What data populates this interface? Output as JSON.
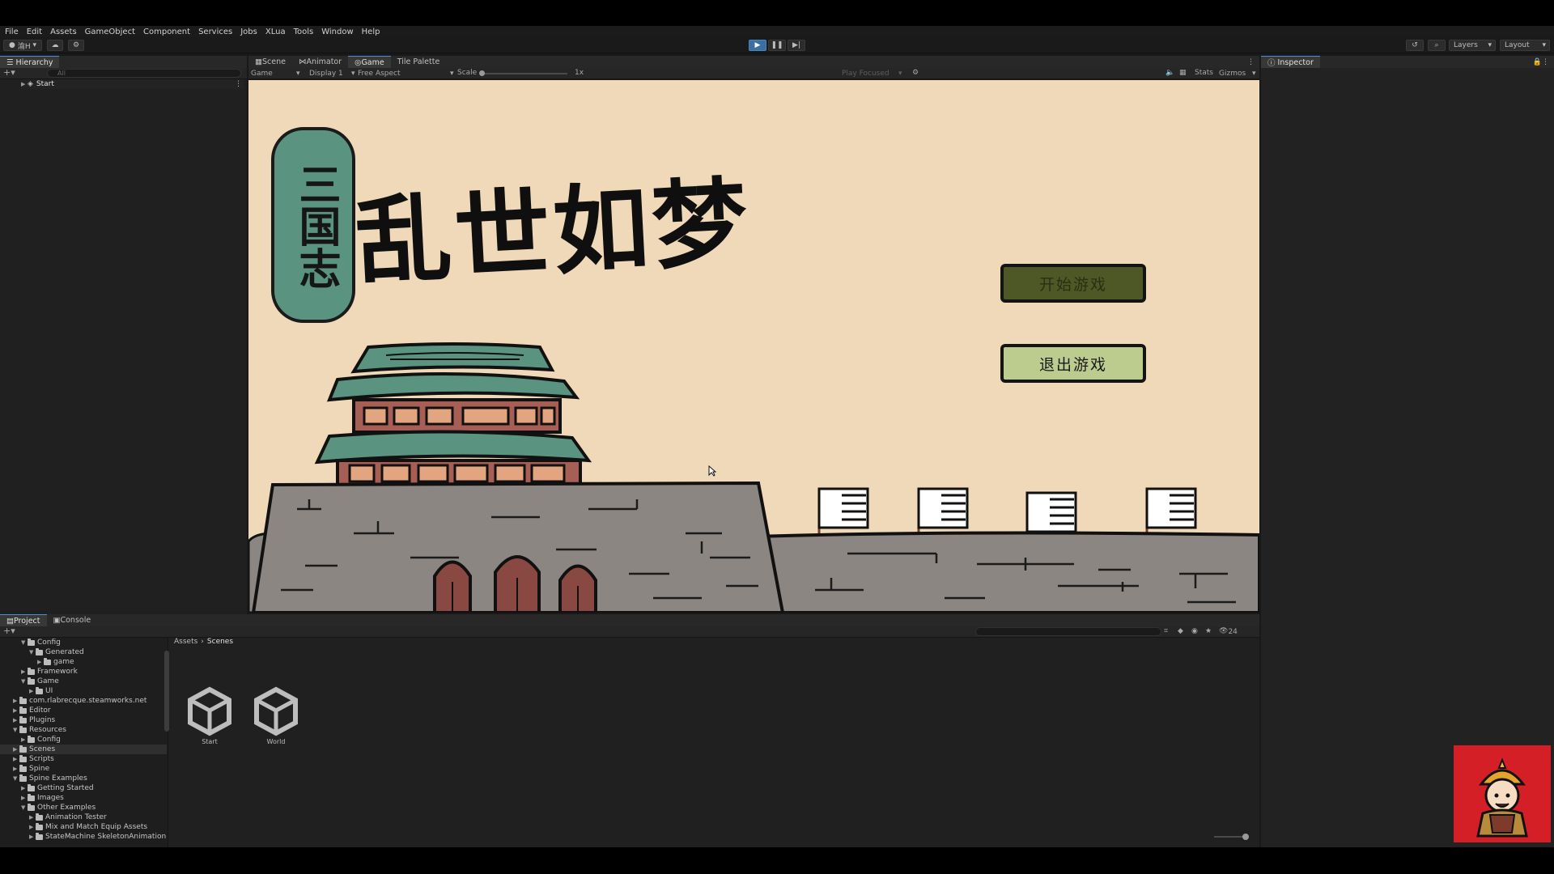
{
  "menu": [
    "File",
    "Edit",
    "Assets",
    "GameObject",
    "Component",
    "Services",
    "Jobs",
    "XLua",
    "Tools",
    "Window",
    "Help"
  ],
  "toolbar": {
    "account_label": "渝H",
    "layers_label": "Layers",
    "layout_label": "Layout"
  },
  "hierarchy": {
    "tab": "Hierarchy",
    "search_placeholder": "All",
    "root_item": "Start"
  },
  "center_tabs": [
    "Scene",
    "Animator",
    "Game",
    "Tile Palette"
  ],
  "game_toolbar": {
    "mode": "Game",
    "display": "Display 1",
    "aspect": "Free Aspect",
    "scale_label": "Scale",
    "scale_value": "1x",
    "play_focused": "Play Focused",
    "stats": "Stats",
    "gizmos": "Gizmos"
  },
  "inspector": {
    "tab": "Inspector"
  },
  "game": {
    "title_side": "三国志",
    "title_main": "乱世如梦",
    "start_button": "开始游戏",
    "quit_button": "退出游戏"
  },
  "bottom_tabs": [
    "Project",
    "Console"
  ],
  "project": {
    "breadcrumb_root": "Assets",
    "breadcrumb_current": "Scenes",
    "hidden_count": "24",
    "tree": [
      {
        "label": "Config",
        "depth": 2,
        "open": true
      },
      {
        "label": "Generated",
        "depth": 3,
        "open": true
      },
      {
        "label": "game",
        "depth": 4,
        "open": false
      },
      {
        "label": "Framework",
        "depth": 2,
        "open": false
      },
      {
        "label": "Game",
        "depth": 2,
        "open": true
      },
      {
        "label": "UI",
        "depth": 3,
        "open": false
      },
      {
        "label": "com.rlabrecque.steamworks.net",
        "depth": 1,
        "open": false
      },
      {
        "label": "Editor",
        "depth": 1,
        "open": false
      },
      {
        "label": "Plugins",
        "depth": 1,
        "open": false
      },
      {
        "label": "Resources",
        "depth": 1,
        "open": true
      },
      {
        "label": "Config",
        "depth": 2,
        "open": false
      },
      {
        "label": "Scenes",
        "depth": 1,
        "open": false,
        "selected": true
      },
      {
        "label": "Scripts",
        "depth": 1,
        "open": false
      },
      {
        "label": "Spine",
        "depth": 1,
        "open": false
      },
      {
        "label": "Spine Examples",
        "depth": 1,
        "open": true
      },
      {
        "label": "Getting Started",
        "depth": 2,
        "open": false
      },
      {
        "label": "Images",
        "depth": 2,
        "open": false
      },
      {
        "label": "Other Examples",
        "depth": 2,
        "open": true
      },
      {
        "label": "Animation Tester",
        "depth": 3,
        "open": false
      },
      {
        "label": "Mix and Match Equip Assets",
        "depth": 3,
        "open": false
      },
      {
        "label": "StateMachine SkeletonAnimation",
        "depth": 3,
        "open": false
      }
    ],
    "assets": [
      "Start",
      "World"
    ]
  },
  "colors": {
    "accent": "#4d8ed8",
    "game_bg": "#efd9b8",
    "start_btn": "#4e5726",
    "quit_btn": "#bccb8e",
    "wall": "#8b8682",
    "roof": "#5a9480"
  }
}
